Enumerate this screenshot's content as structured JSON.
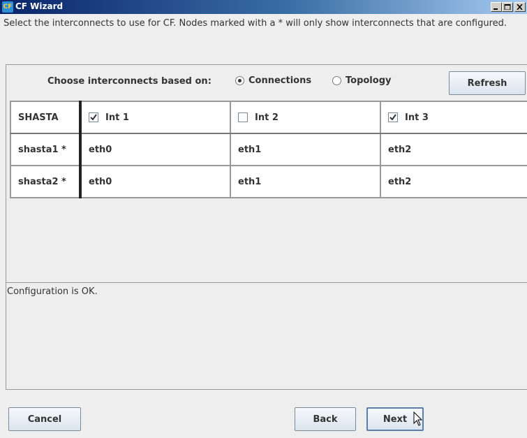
{
  "window": {
    "title": "CF Wizard",
    "icon": "cf-app-icon",
    "icon_text": "CF"
  },
  "description": "Select the interconnects to use for CF.  Nodes marked with a * will only show interconnects that are configured.",
  "choose": {
    "label": "Choose interconnects based on:",
    "options": [
      {
        "label": "Connections",
        "selected": true
      },
      {
        "label": "Topology",
        "selected": false
      }
    ],
    "refresh_label": "Refresh"
  },
  "table": {
    "corner": "SHASTA",
    "columns": [
      {
        "label": "Int 1",
        "checked": true
      },
      {
        "label": "Int 2",
        "checked": false
      },
      {
        "label": "Int 3",
        "checked": true
      }
    ],
    "rows": [
      {
        "node": "shasta1 *",
        "cells": [
          "eth0",
          "eth1",
          "eth2"
        ]
      },
      {
        "node": "shasta2 *",
        "cells": [
          "eth0",
          "eth1",
          "eth2"
        ]
      }
    ]
  },
  "status": "Configuration is OK.",
  "buttons": {
    "cancel": "Cancel",
    "back": "Back",
    "next": "Next"
  },
  "colors": {
    "background": "#eeeeee",
    "titlebar": "#0a246a"
  }
}
